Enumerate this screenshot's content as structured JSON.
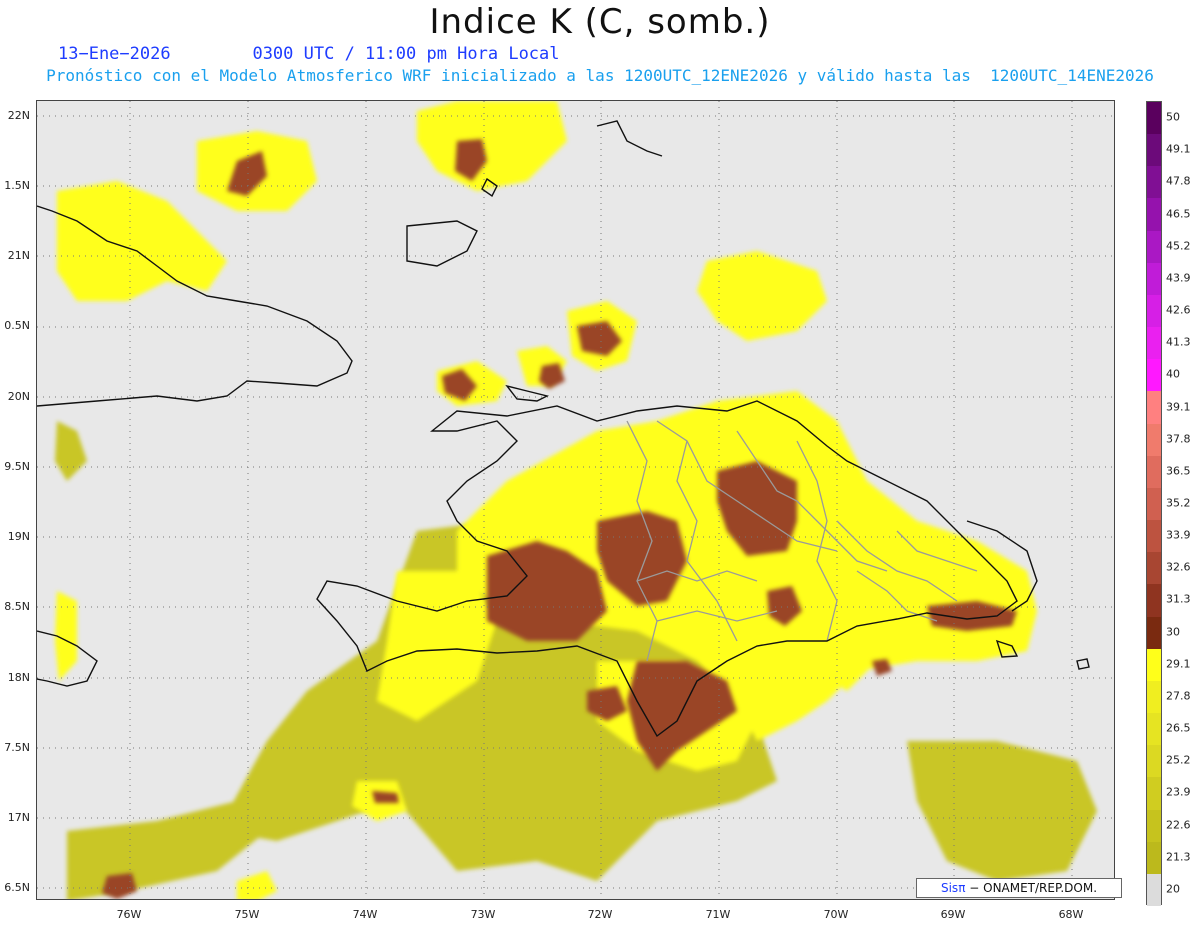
{
  "title": "Indice K (C, somb.)",
  "subtitle_line1": "13−Ene−2026        0300 UTC / 11:00 pm Hora Local",
  "subtitle_line2": "Pronóstico con el Modelo Atmosferico WRF inicializado a las 1200UTC_12ENE2026 y válido hasta las  1200UTC_14ENE2026",
  "credit": {
    "brand": "Sisπ",
    "text": "− ONAMET/REP.DOM."
  },
  "lat_labels": [
    "22N",
    "1.5N",
    "21N",
    "0.5N",
    "20N",
    "9.5N",
    "19N",
    "8.5N",
    "18N",
    "7.5N",
    "17N",
    "6.5N"
  ],
  "lon_labels": [
    "76W",
    "75W",
    "74W",
    "73W",
    "72W",
    "71W",
    "70W",
    "69W",
    "68W"
  ],
  "colorbar": {
    "levels": [
      "50",
      "49.1",
      "47.8",
      "46.5",
      "45.2",
      "43.9",
      "42.6",
      "41.3",
      "40",
      "39.1",
      "37.8",
      "36.5",
      "35.2",
      "33.9",
      "32.6",
      "31.3",
      "30",
      "29.1",
      "27.8",
      "26.5",
      "25.2",
      "23.9",
      "22.6",
      "21.3",
      "20"
    ],
    "colors": [
      "#5a005e",
      "#6c0a7a",
      "#800f94",
      "#9512ad",
      "#aa18c4",
      "#c01cd8",
      "#d61fe6",
      "#ea20f0",
      "#ff18ff",
      "#ff8080",
      "#f07b6c",
      "#e06c5e",
      "#d06050",
      "#bd5340",
      "#a84632",
      "#8f3420",
      "#7a2a10",
      "#ffff1a",
      "#f0ee20",
      "#e6e422",
      "#dcd922",
      "#d0cd20",
      "#c6c31e",
      "#bcb91c",
      "#dcdcdc"
    ]
  },
  "colors": {
    "background": "#e8e8e8",
    "k_brown": "#9a4428",
    "k_yellow": "#ffff1a",
    "k_olive": "#c9c626"
  }
}
